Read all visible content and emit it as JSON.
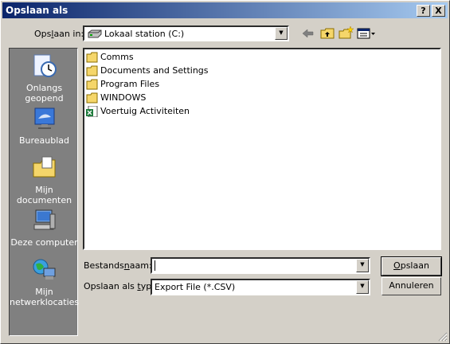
{
  "window": {
    "title": "Opslaan als",
    "help_label": "?",
    "close_label": "X"
  },
  "save_in": {
    "label_prefix": "Ops",
    "label_underline": "l",
    "label_suffix": "aan in:",
    "value": "Lokaal station (C:)"
  },
  "places": [
    {
      "label": "Onlangs geopend",
      "icon": "recent-documents-icon"
    },
    {
      "label": "Bureaublad",
      "icon": "desktop-icon"
    },
    {
      "label": "Mijn documenten",
      "icon": "my-documents-icon"
    },
    {
      "label": "Deze computer",
      "icon": "my-computer-icon"
    },
    {
      "label": "Mijn netwerklocaties",
      "icon": "network-places-icon"
    }
  ],
  "files": [
    {
      "name": "Comms",
      "icon": "folder-icon"
    },
    {
      "name": "Documents and Settings",
      "icon": "folder-icon"
    },
    {
      "name": "Program Files",
      "icon": "folder-icon"
    },
    {
      "name": "WINDOWS",
      "icon": "folder-icon"
    },
    {
      "name": "Voertuig Activiteiten",
      "icon": "excel-file-icon"
    }
  ],
  "filename": {
    "label_prefix": "Bestands",
    "label_underline": "n",
    "label_suffix": "aam:",
    "value": ""
  },
  "filetype": {
    "label_prefix": "Opslaan als ",
    "label_underline": "t",
    "label_suffix": "ype:",
    "value": "Export File (*.CSV)"
  },
  "buttons": {
    "save_underline": "O",
    "save_rest": "pslaan",
    "cancel": "Annuleren"
  },
  "colors": {
    "titlebar_start": "#0a246a",
    "titlebar_end": "#a6caf0",
    "dialog_bg": "#d4d0c8",
    "places_bg": "#808080"
  }
}
